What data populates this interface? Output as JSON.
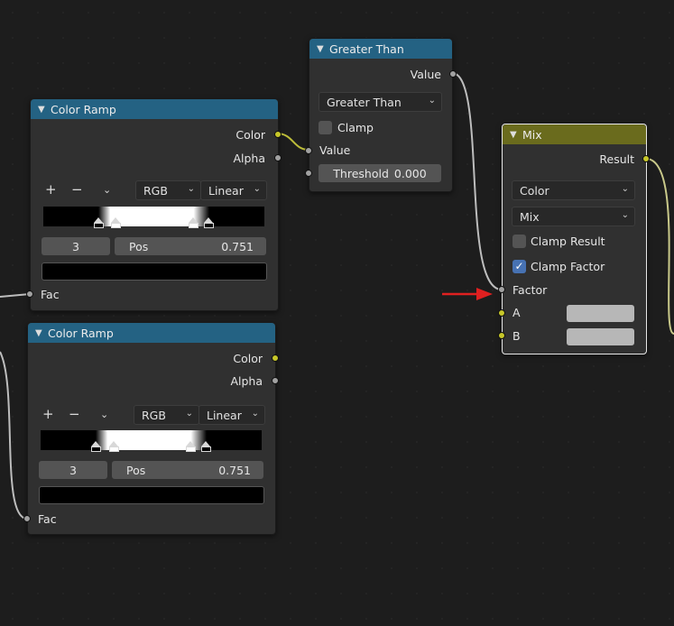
{
  "color_ramp_1": {
    "title": "Color Ramp",
    "outputs": [
      "Color",
      "Alpha"
    ],
    "add_icon": "+",
    "remove_icon": "−",
    "color_mode": "RGB",
    "interpolation": "Linear",
    "active_stop_index": "3",
    "pos_label": "Pos",
    "pos_value": "0.751",
    "input_label": "Fac"
  },
  "color_ramp_2": {
    "title": "Color Ramp",
    "outputs": [
      "Color",
      "Alpha"
    ],
    "add_icon": "+",
    "remove_icon": "−",
    "color_mode": "RGB",
    "interpolation": "Linear",
    "active_stop_index": "3",
    "pos_label": "Pos",
    "pos_value": "0.751",
    "input_label": "Fac"
  },
  "greater_than": {
    "title": "Greater Than",
    "output": "Value",
    "operation": "Greater Than",
    "clamp_label": "Clamp",
    "clamp_checked": false,
    "input_value": "Value",
    "threshold_label": "Threshold",
    "threshold_value": "0.000"
  },
  "mix": {
    "title": "Mix",
    "output": "Result",
    "data_type": "Color",
    "blend_mode": "Mix",
    "clamp_result_label": "Clamp Result",
    "clamp_result_checked": false,
    "clamp_factor_label": "Clamp Factor",
    "clamp_factor_checked": true,
    "inputs": [
      "Factor",
      "A",
      "B"
    ]
  },
  "colors": {
    "header_blue": "#246283",
    "header_olive": "#6a6b1d",
    "socket_yellow": "#c7c729",
    "socket_grey": "#a1a1a1",
    "annotation_arrow": "#e02020"
  },
  "icons": [
    "chevron-down-icon",
    "plus-icon",
    "minus-icon",
    "check-icon",
    "red-arrow-annotation"
  ]
}
